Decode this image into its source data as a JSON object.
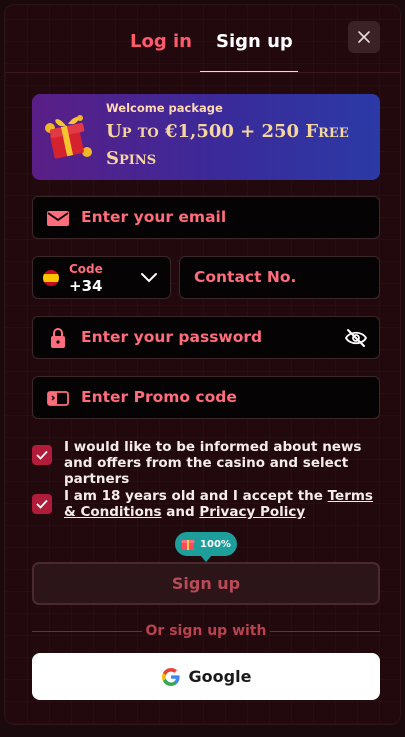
{
  "tabs": {
    "login": "Log in",
    "signup": "Sign up"
  },
  "banner": {
    "subtitle": "Welcome package",
    "title": "Up to €1,500 + 250 Free Spins"
  },
  "form": {
    "email_placeholder": "Enter your email",
    "code_label": "Code",
    "code_value": "+34",
    "contact_placeholder": "Contact No.",
    "password_placeholder": "Enter your password",
    "promo_placeholder": "Enter Promo code"
  },
  "checks": {
    "news": "I would like to be informed about news and offers from the casino and select partners",
    "age_prefix": "I am 18 years old and I accept the ",
    "terms_link": "Terms & Conditions",
    "and": " and ",
    "privacy_link": "Privacy Policy"
  },
  "progress_badge": {
    "label": "100%",
    "value_percent": 100
  },
  "signup_button": "Sign up",
  "or_text": "Or sign up with",
  "google_button": "Google",
  "colors": {
    "accent": "#ff5a6b",
    "background": "#22090d",
    "checkbox": "#b01c3a",
    "badge": "#1e9e9a"
  },
  "icons": [
    "close-icon",
    "gift-icon",
    "email-icon",
    "spain-flag-icon",
    "chevron-down-icon",
    "lock-icon",
    "eye-off-icon",
    "promo-ticket-icon",
    "check-icon",
    "google-icon"
  ]
}
